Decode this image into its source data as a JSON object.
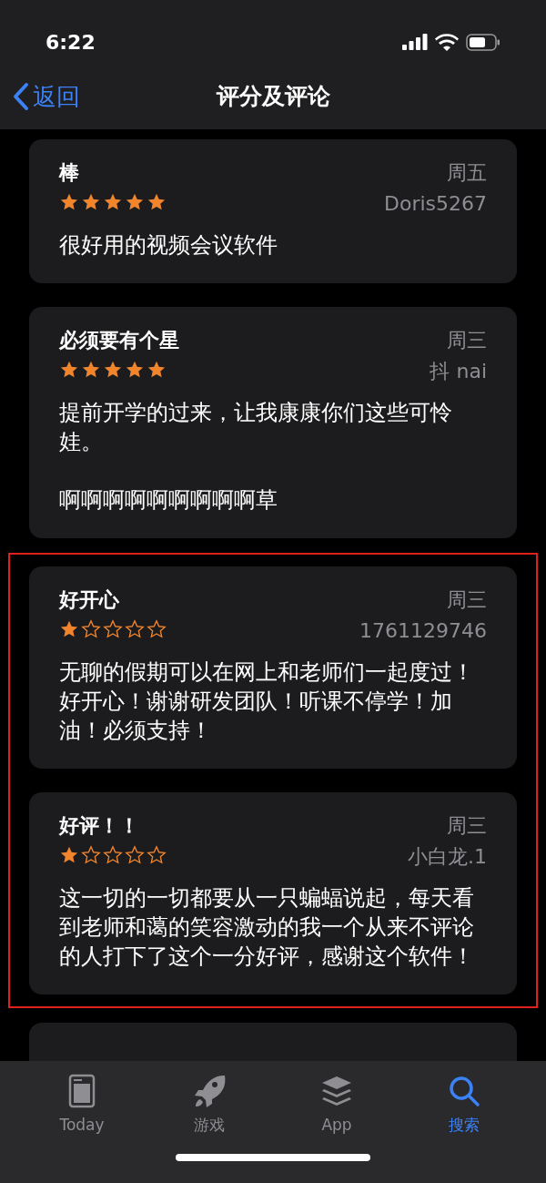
{
  "status_bar": {
    "time": "6:22"
  },
  "nav": {
    "back": "返回",
    "title": "评分及评论"
  },
  "reviews": [
    {
      "title": "棒",
      "date": "周五",
      "author": "Doris5267",
      "stars": 5,
      "body": [
        "很好用的视频会议软件"
      ],
      "highlighted": false
    },
    {
      "title": "必须要有个星",
      "date": "周三",
      "author": "抖 nai",
      "stars": 5,
      "body": [
        "提前开学的过来，让我康康你们这些可怜娃。",
        "啊啊啊啊啊啊啊啊啊草"
      ],
      "highlighted": false
    },
    {
      "title": "好开心",
      "date": "周三",
      "author": "1761129746",
      "stars": 1,
      "body": [
        "无聊的假期可以在网上和老师们一起度过！好开心！谢谢研发团队！听课不停学！加油！必须支持！"
      ],
      "highlighted": true
    },
    {
      "title": "好评！！",
      "date": "周三",
      "author": "小白龙.1",
      "stars": 1,
      "body": [
        "这一切的一切都要从一只蝙蝠说起，每天看到老师和蔼的笑容激动的我一个从来不评论的人打下了这个一分好评，感谢这个软件！"
      ],
      "highlighted": true
    }
  ],
  "tabs": [
    {
      "kind": "today",
      "label": "Today",
      "selected": false
    },
    {
      "kind": "games",
      "label": "游戏",
      "selected": false
    },
    {
      "kind": "apps",
      "label": "App",
      "selected": false
    },
    {
      "kind": "search",
      "label": "搜索",
      "selected": true
    }
  ]
}
